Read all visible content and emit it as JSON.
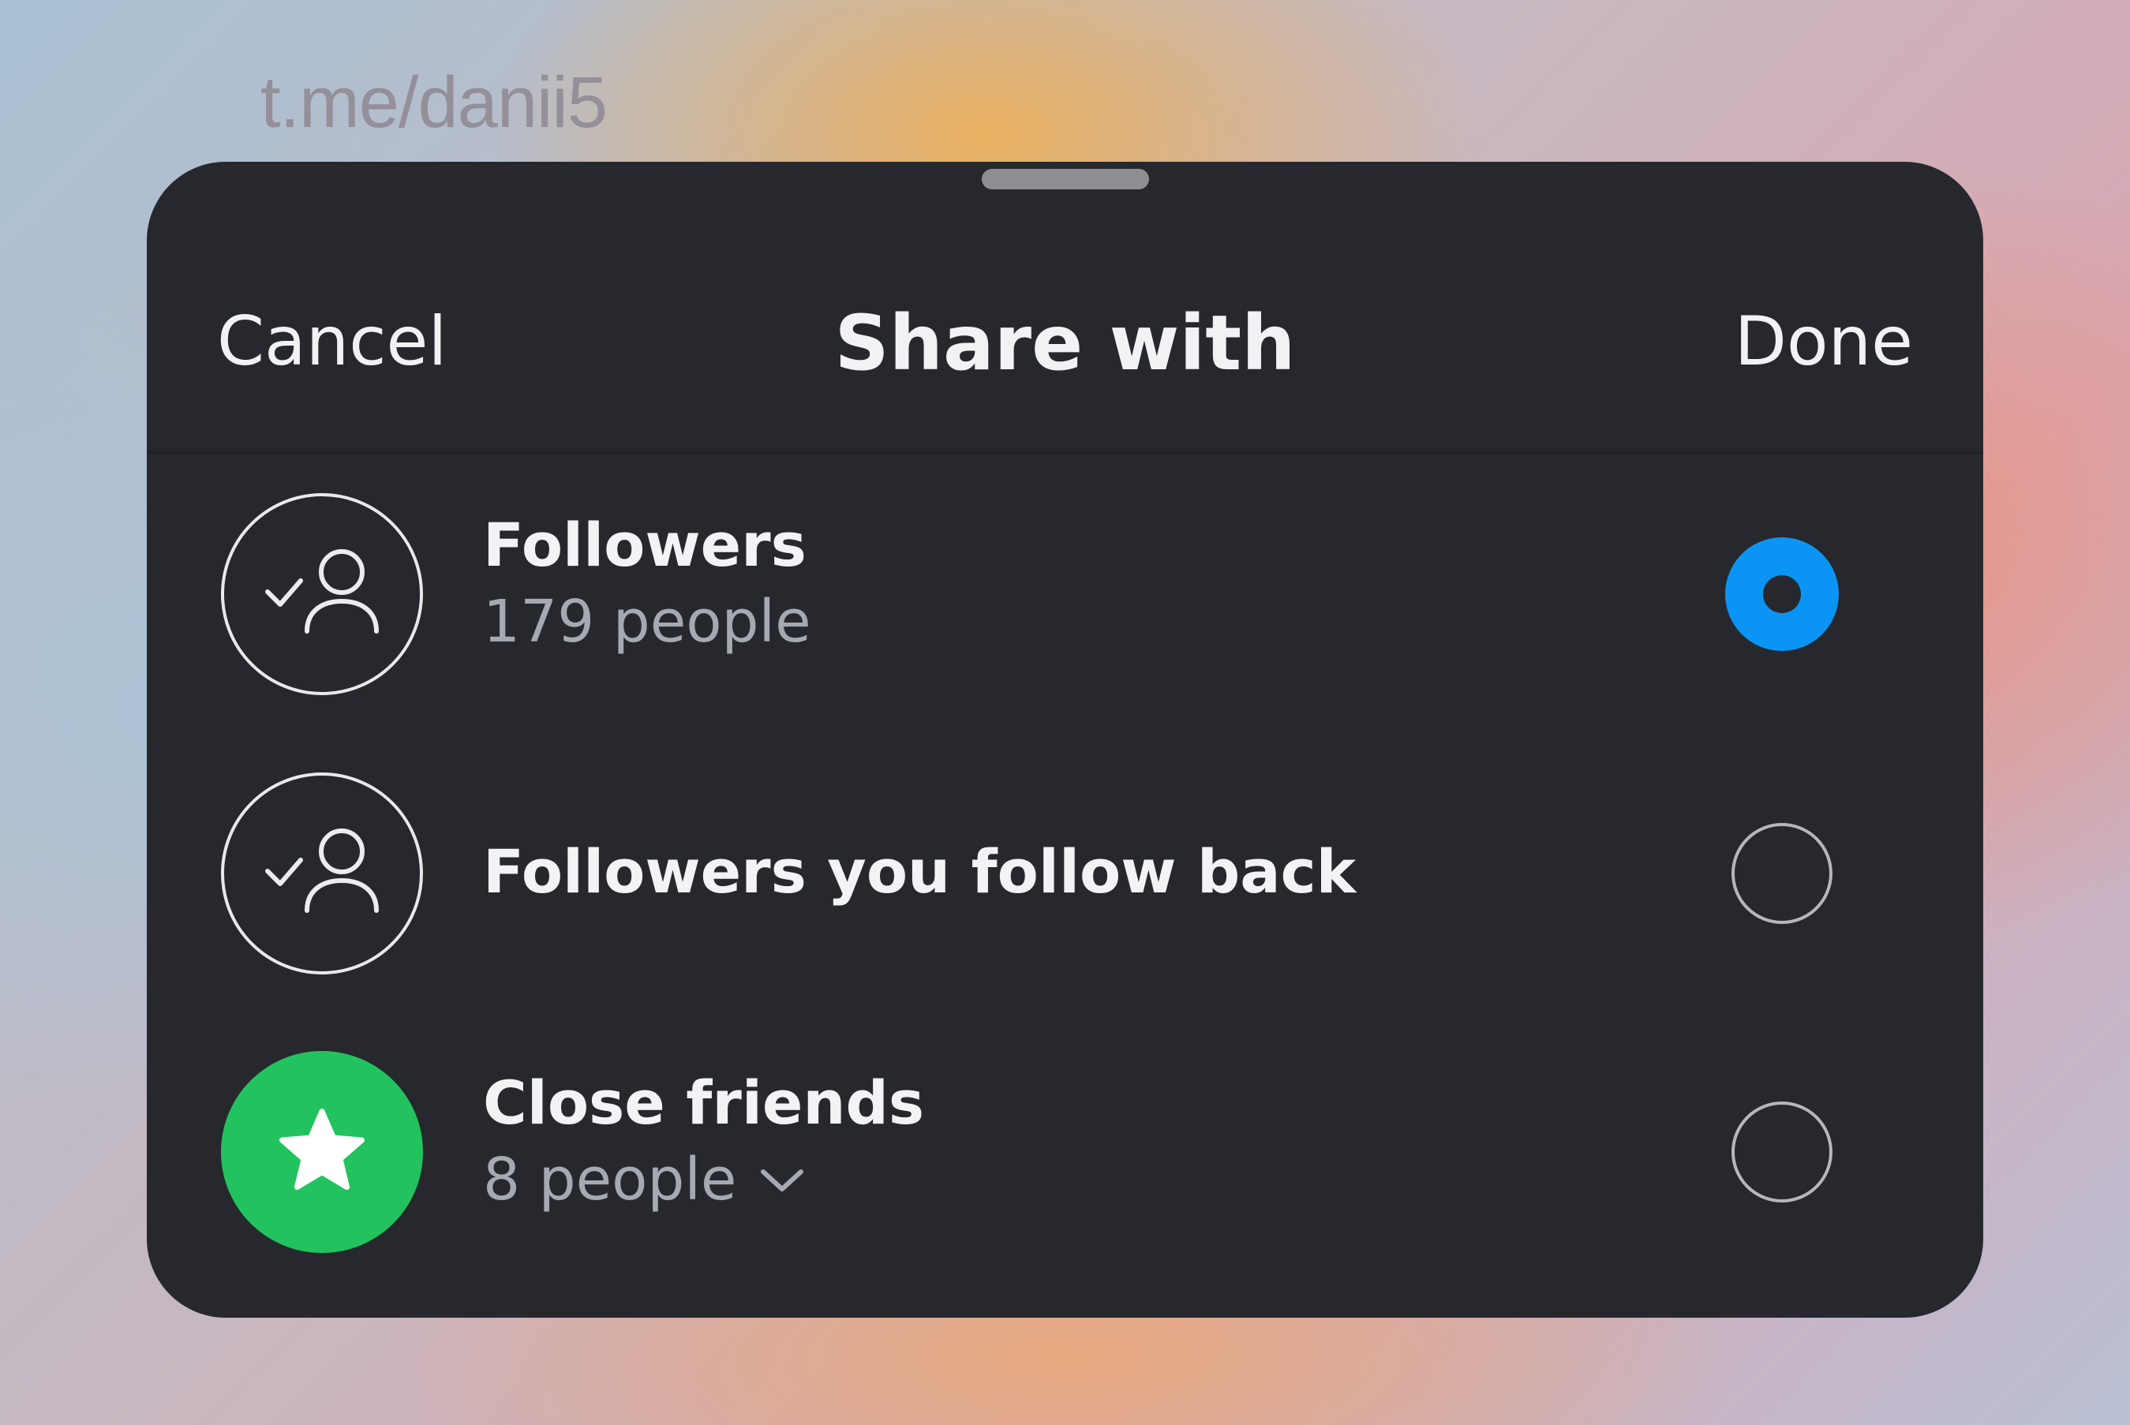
{
  "watermark": "t.me/danii5",
  "header": {
    "cancel_label": "Cancel",
    "title": "Share with",
    "done_label": "Done"
  },
  "options": [
    {
      "label": "Followers",
      "sublabel": "179 people",
      "icon": "followers-icon",
      "selected": true
    },
    {
      "label": "Followers you follow back",
      "sublabel": "",
      "icon": "followers-icon",
      "selected": false
    },
    {
      "label": "Close friends",
      "sublabel": "8 people",
      "icon": "star-icon",
      "selected": false
    }
  ],
  "colors": {
    "sheet_bg": "#26282d",
    "accent_blue": "#0a95f5",
    "close_friends_green": "#22c35e"
  }
}
